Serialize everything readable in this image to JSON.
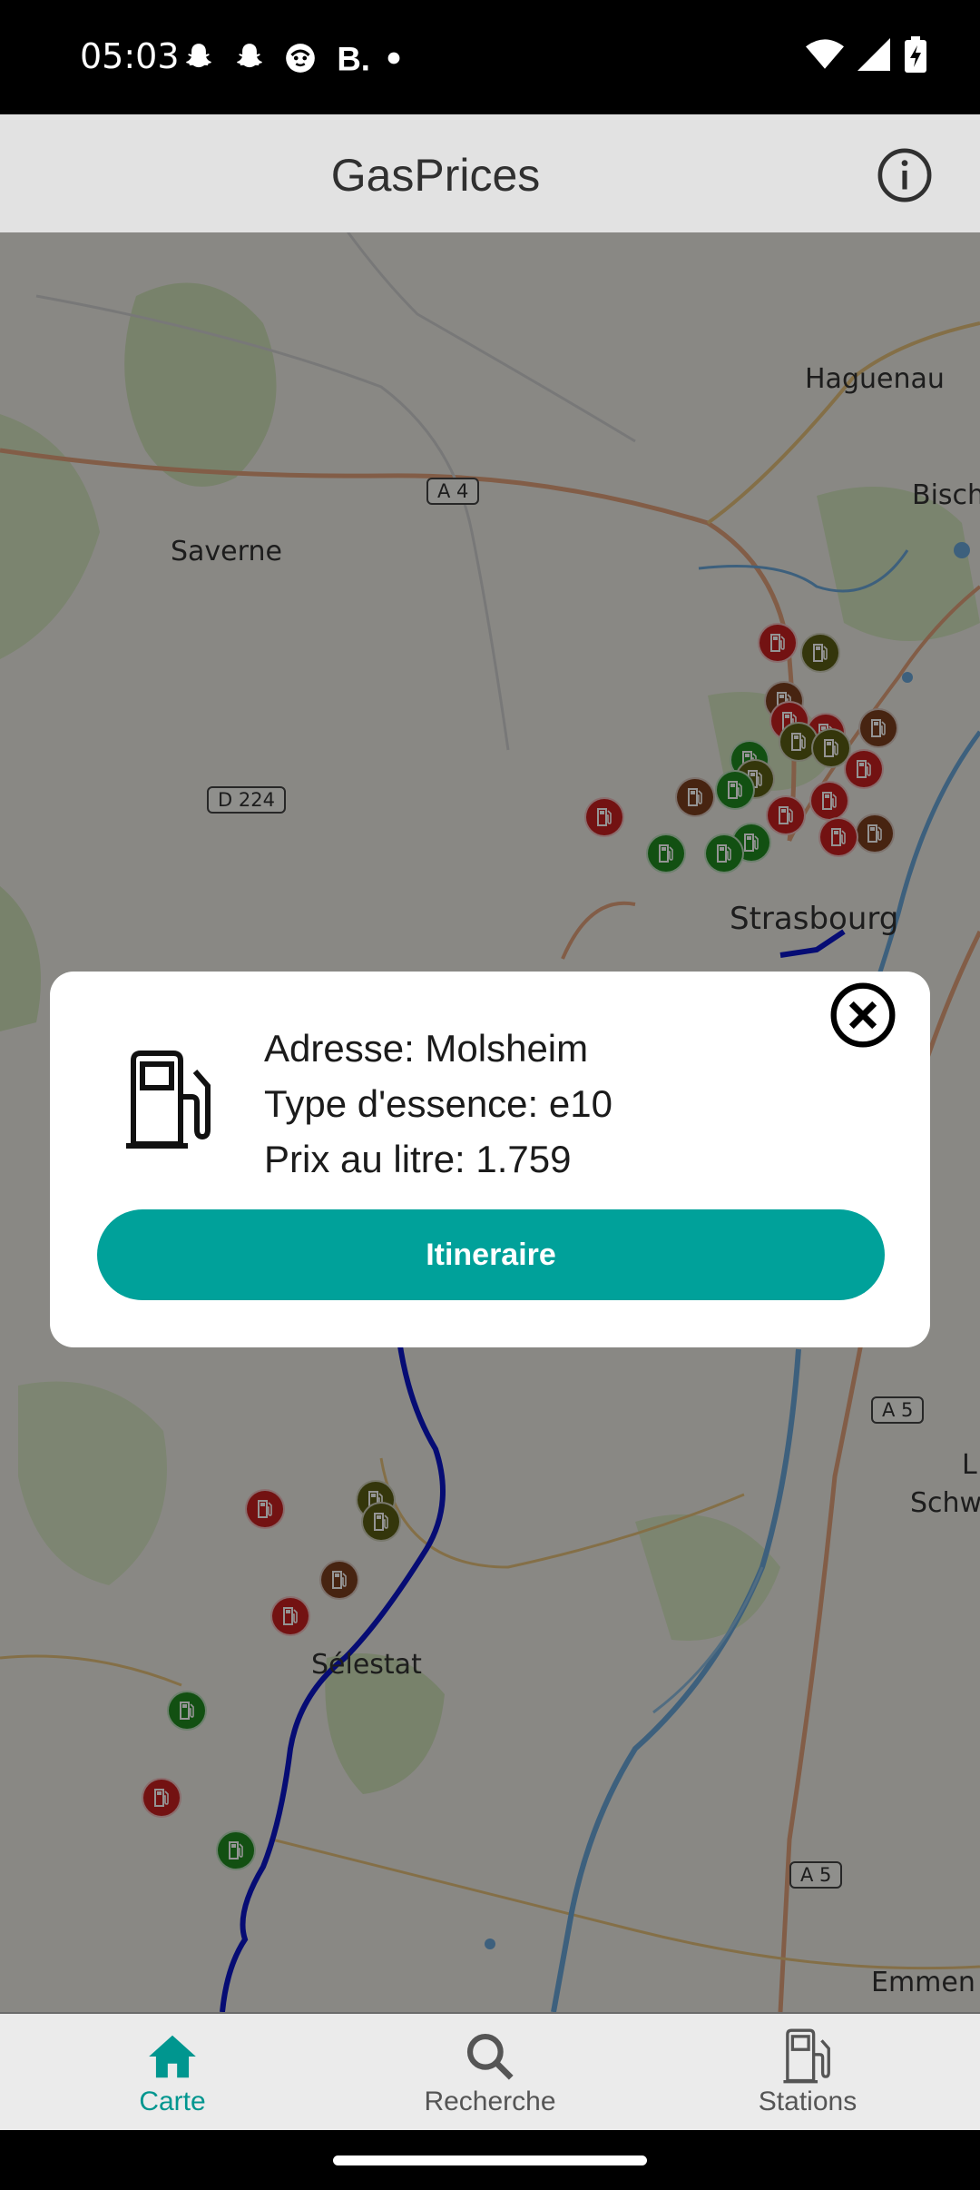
{
  "status_bar": {
    "time": "05:03",
    "notification_icons": [
      "snapchat-icon",
      "snapchat-icon",
      "emoji-app-icon",
      "b-app-icon",
      "dot-icon"
    ],
    "system_icons": [
      "wifi-icon",
      "signal-icon",
      "battery-charging-icon"
    ]
  },
  "app_bar": {
    "title": "GasPrices",
    "info_icon": "info-icon"
  },
  "map": {
    "places": [
      "Haguenau",
      "Bisch",
      "Saverne",
      "Strasbourg",
      "Sélestat",
      "L",
      "Schw",
      "Emmen"
    ],
    "road_signs": [
      "A 4",
      "D 224",
      "A 5",
      "A 5"
    ],
    "marker_colors": {
      "red": "#c62020",
      "brown": "#7b3e1e",
      "olive": "#5b5d14",
      "green": "#1f8a1f"
    },
    "route_color": "#0b16c8"
  },
  "dialog": {
    "icon": "gas-pump-icon",
    "address": "Adresse: Molsheim",
    "fuel_type": "Type d'essence: e10",
    "price": "Prix au litre: 1.759",
    "button": "Itineraire",
    "close_icon": "close-circle-icon",
    "accent": "#00a19a"
  },
  "bottom_nav": {
    "items": [
      {
        "label": "Carte",
        "icon": "home-icon",
        "active": true
      },
      {
        "label": "Recherche",
        "icon": "search-icon",
        "active": false
      },
      {
        "label": "Stations",
        "icon": "gas-pump-icon",
        "active": false
      }
    ],
    "active_color": "#00968f"
  }
}
